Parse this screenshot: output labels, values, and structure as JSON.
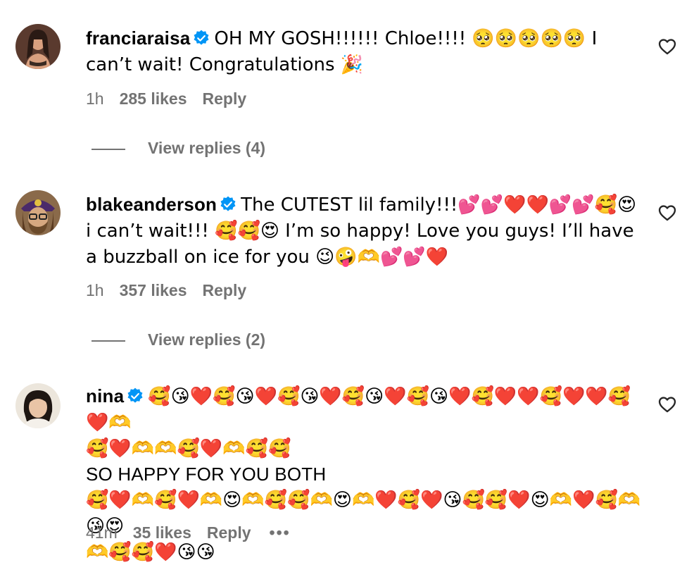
{
  "comments": [
    {
      "username": "franciaraisa",
      "text": "OH MY GOSH!!!!!! Chloe!!!! 🥺🥺🥺🥺🥺 I can’t wait! Congratulations 🎉",
      "time": "1h",
      "likes": "285 likes",
      "reply": "Reply",
      "view_replies": "View replies (4)"
    },
    {
      "username": "blakeanderson",
      "text": "The CUTEST lil family!!!💕💕❤️❤️💕💕🥰😍 i can’t wait!!! 🥰🥰😍 I’m so happy! Love you guys! I’ll have a buzzball on ice for you 😉🤪🫶💕💕❤️",
      "time": "1h",
      "likes": "357 likes",
      "reply": "Reply",
      "view_replies": "View replies (2)"
    },
    {
      "username": "nina",
      "line1": "🥰😘❤️🥰😘❤️🥰😘❤️🥰😘❤️🥰😘❤️🥰❤️❤️🥰❤️❤️🥰❤️🫶",
      "line2": "🥰❤️🫶🫶🥰❤️🫶🥰🥰",
      "line3": "SO HAPPY FOR YOU BOTH",
      "line4": "🥰❤️🫶🥰❤️🫶😍🫶🥰🥰🫶😍🫶❤️🥰❤️😘🥰🥰❤️😍🫶❤️🥰🫶😘😍",
      "line5": "🫶🥰🥰❤️😘😘",
      "time": "41m",
      "likes": "35 likes",
      "reply": "Reply",
      "more": "•••"
    }
  ],
  "colors": {
    "verified": "#0095f6",
    "meta": "#737373"
  },
  "icons": {
    "verified": "verified-badge-icon",
    "like": "heart-outline-icon",
    "more": "more-dots-icon"
  }
}
